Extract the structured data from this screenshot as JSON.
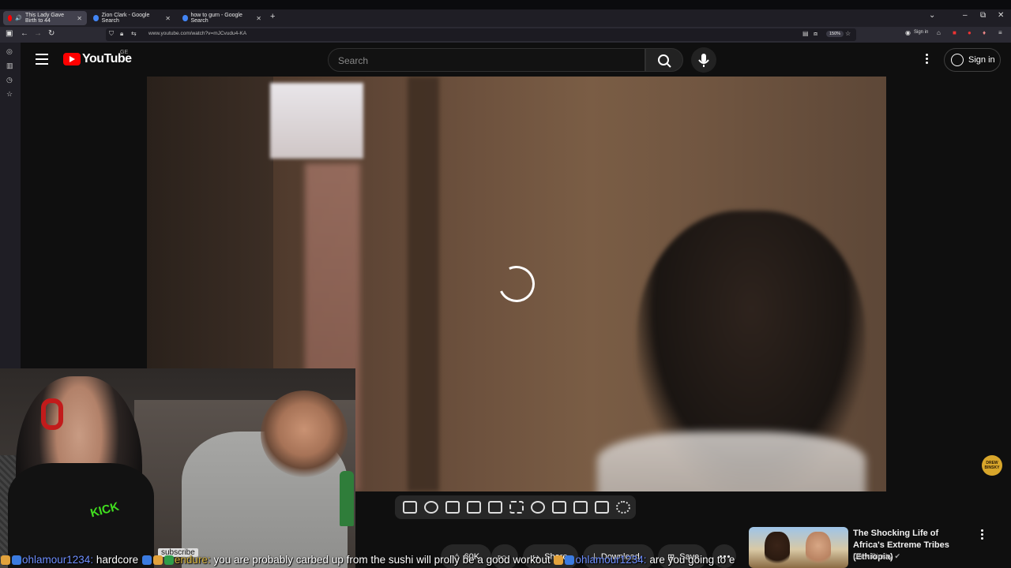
{
  "browser": {
    "tabs": [
      {
        "label": "This Lady Gave Birth to 44",
        "active": true,
        "favicon_color": "#ff0000"
      },
      {
        "label": "Zion Clark - Google Search",
        "active": false,
        "favicon_color": "#4285f4"
      },
      {
        "label": "how to gurn - Google Search",
        "active": false,
        "favicon_color": "#4285f4"
      }
    ],
    "url": "www.youtube.com/watch?v=mJCvudu4-KA",
    "zoom": "150%",
    "signin_label": "Sign in"
  },
  "youtube": {
    "logo_text": "YouTube",
    "country_code": "GE",
    "search_placeholder": "Search",
    "signin_label": "Sign in",
    "brand_color": "#ff0000"
  },
  "video": {
    "state": "buffering",
    "watermark": "DREW BINSKY"
  },
  "extension_toolbar": {
    "icons": [
      "loop-icon",
      "audio-icon",
      "speed-view-icon",
      "clapper-icon",
      "aspect-icon",
      "theater-icon",
      "speedometer-icon",
      "add-icon",
      "screenshot-icon",
      "keyboard-icon",
      "settings-icon"
    ]
  },
  "actions": {
    "like_count": "60K",
    "share_label": "Share",
    "download_label": "Download",
    "save_label": "Save"
  },
  "recommendation": {
    "title": "The Shocking Life of Africa's Extreme Tribes (Ethiopia)",
    "channel": "Drew Binsky"
  },
  "stream_overlay": {
    "subscribe_label": "subscribe"
  },
  "chat": {
    "messages": [
      {
        "user": "ohlamour1234:",
        "text": "hardcore"
      },
      {
        "user": "endure:",
        "text": "you are probably carbed up from the sushi will prolly be a good workout"
      },
      {
        "user": "ohlamour1234:",
        "text": "are you going to e"
      }
    ]
  }
}
